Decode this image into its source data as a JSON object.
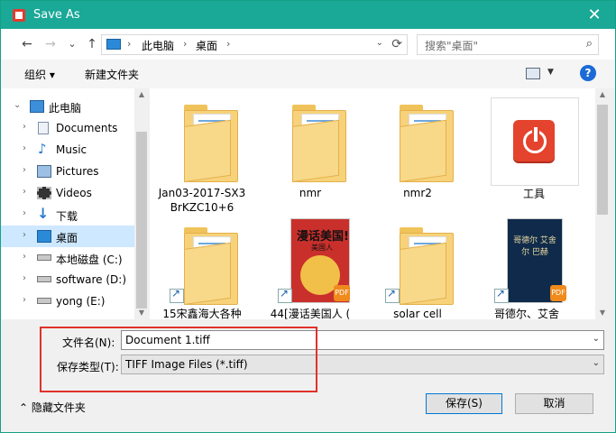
{
  "window": {
    "title": "Save As",
    "close_label": "✕"
  },
  "navigation": {
    "back": "←",
    "forward": "→",
    "recent": "⌄",
    "up": "↑",
    "path": [
      "此电脑",
      "桌面"
    ],
    "separator": "›",
    "refresh": "⟳",
    "search_placeholder": "搜索\"桌面\""
  },
  "toolbar": {
    "organize": "组织 ▾",
    "new_folder": "新建文件夹",
    "help": "?"
  },
  "sidebar": {
    "items": [
      {
        "label": "此电脑",
        "arrow": "⌄",
        "icon": "pc-icon"
      },
      {
        "label": "Documents",
        "arrow": "›",
        "icon": "documents-icon"
      },
      {
        "label": "Music",
        "arrow": "›",
        "icon": "music-icon"
      },
      {
        "label": "Pictures",
        "arrow": "›",
        "icon": "pictures-icon"
      },
      {
        "label": "Videos",
        "arrow": "›",
        "icon": "videos-icon"
      },
      {
        "label": "下载",
        "arrow": "›",
        "icon": "downloads-icon"
      },
      {
        "label": "桌面",
        "arrow": "›",
        "icon": "desktop-icon",
        "selected": true
      },
      {
        "label": "本地磁盘 (C:)",
        "arrow": "›",
        "icon": "drive-icon"
      },
      {
        "label": "software (D:)",
        "arrow": "›",
        "icon": "drive-icon"
      },
      {
        "label": "yong (E:)",
        "arrow": "›",
        "icon": "drive-icon"
      }
    ]
  },
  "files": [
    {
      "name_line1": "Jan03-2017-SX3",
      "name_line2": "BrKZC10+6",
      "type": "folder"
    },
    {
      "name_line1": "nmr",
      "type": "folder"
    },
    {
      "name_line1": "nmr2",
      "type": "folder"
    },
    {
      "name_line1": "工具",
      "type": "app"
    },
    {
      "name_line1": "15宋鑫海大各种",
      "type": "folder-shortcut"
    },
    {
      "name_line1": "44[漫话美国人 (",
      "type": "book-shortcut",
      "cover_title": "漫话美国!",
      "cover_sub": "美国人"
    },
    {
      "name_line1": "solar cell",
      "type": "folder-shortcut"
    },
    {
      "name_line1": "哥德尔、艾舍",
      "type": "book-shortcut",
      "cover_title": "哥德尔 艾舍尔 巴赫"
    }
  ],
  "form": {
    "filename_label": "文件名(N):",
    "filename_value": "Document 1.tiff",
    "filetype_label": "保存类型(T):",
    "filetype_value": "TIFF Image Files (*.tiff)"
  },
  "footer": {
    "hide_folders": "隐藏文件夹",
    "save": "保存(S)",
    "cancel": "取消"
  },
  "colors": {
    "titlebar": "#1aa897",
    "selection": "#cde8ff",
    "highlight_box": "#e0332a"
  }
}
